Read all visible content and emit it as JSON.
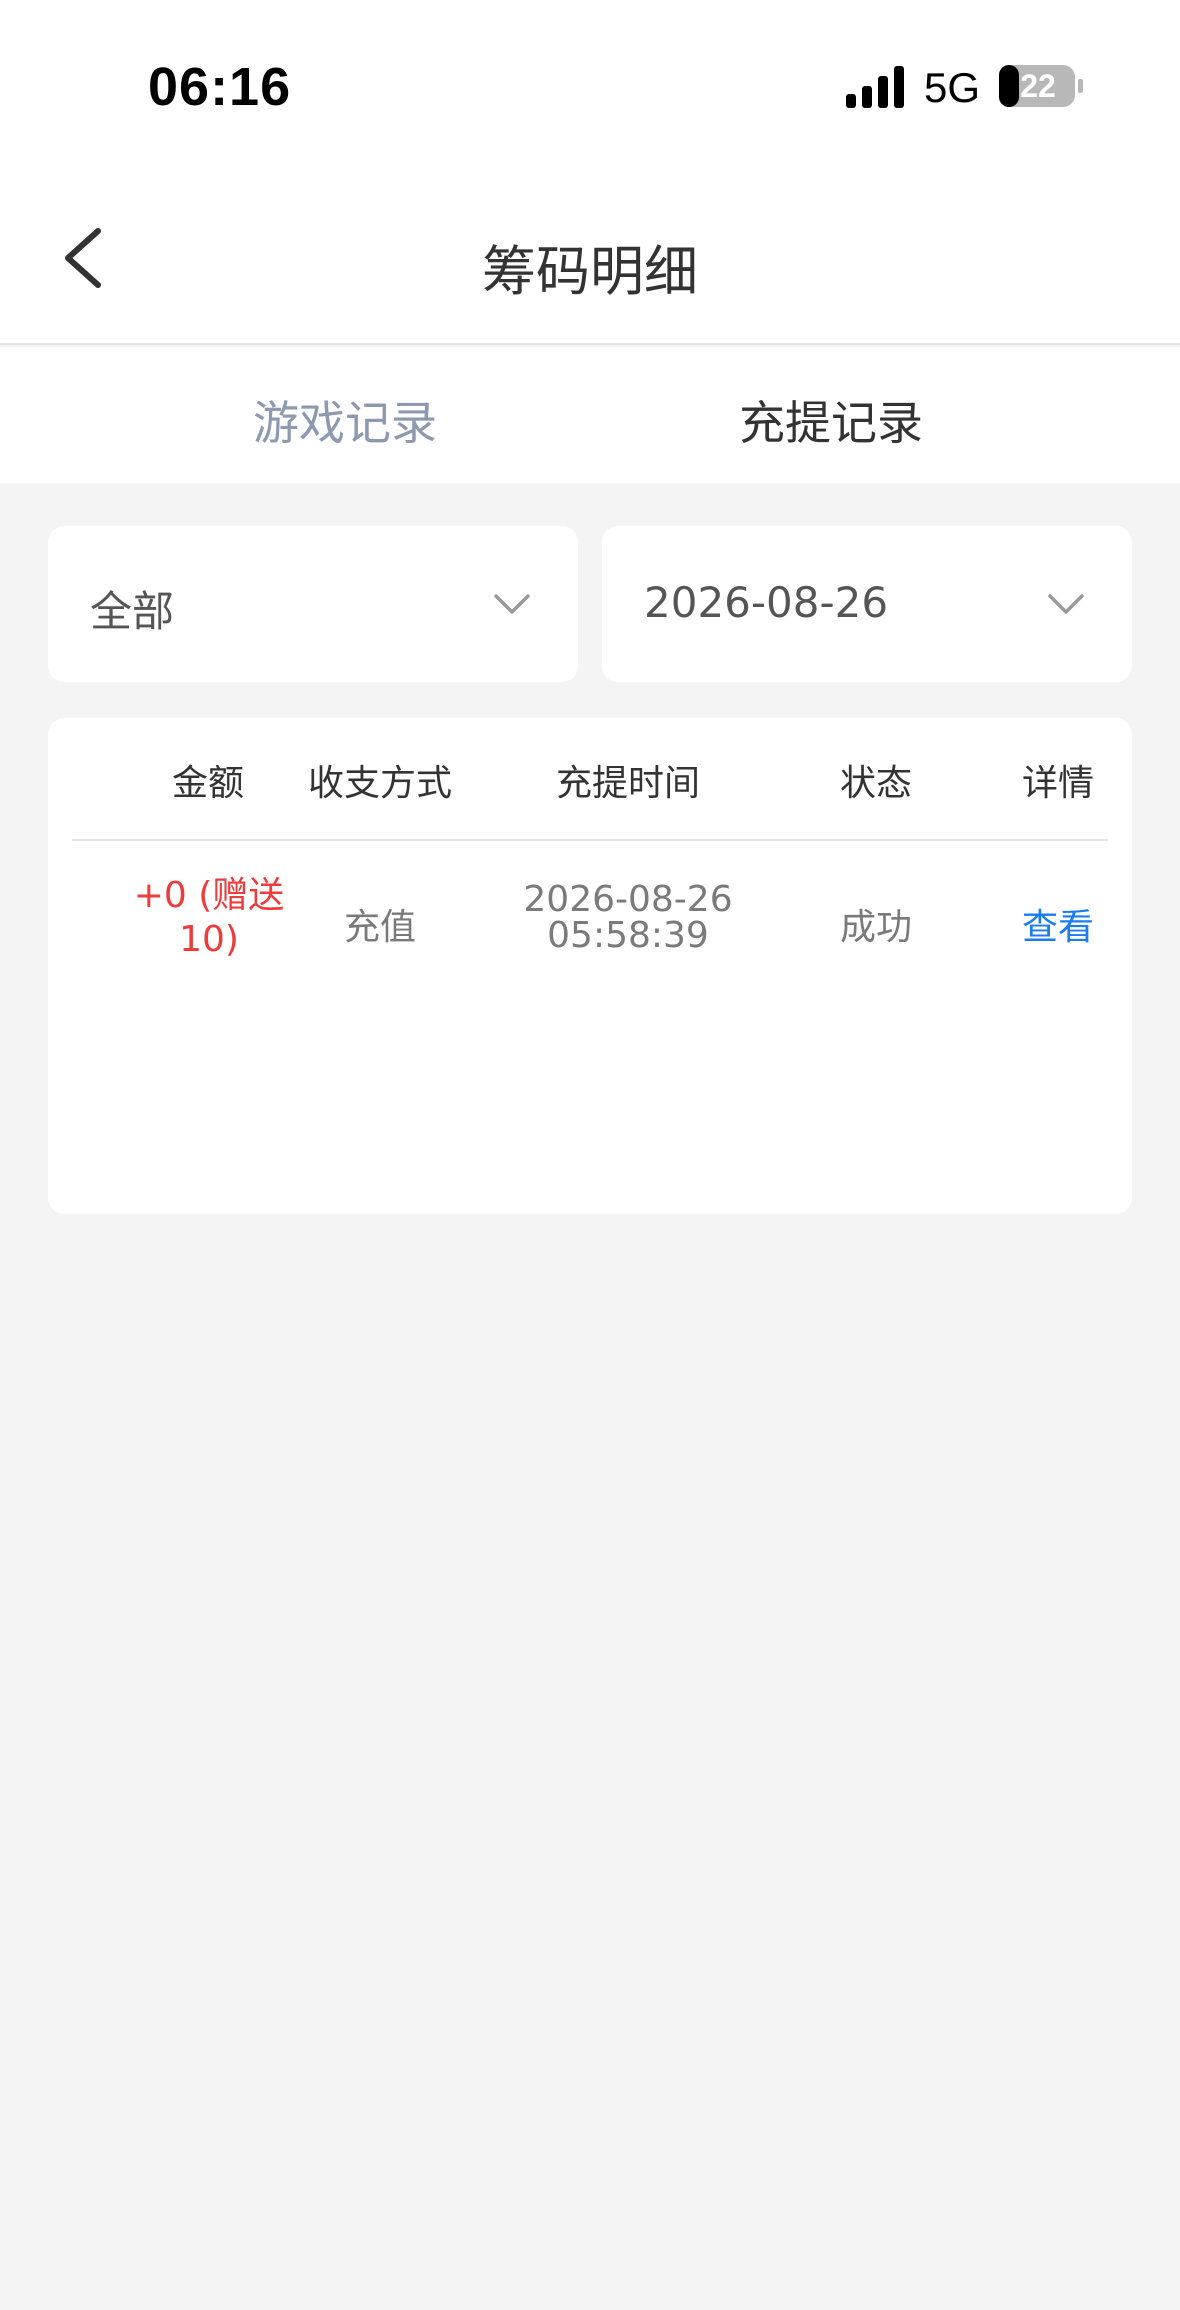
{
  "status_bar": {
    "time": "06:16",
    "network": "5G",
    "battery": "22"
  },
  "header": {
    "title": "筹码明细"
  },
  "tabs": [
    {
      "label": "游戏记录",
      "active": false
    },
    {
      "label": "充提记录",
      "active": true
    }
  ],
  "filters": {
    "type": "全部",
    "date": "2026-08-26"
  },
  "table": {
    "columns": [
      "金额",
      "收支方式",
      "充提时间",
      "状态",
      "详情"
    ],
    "rows": [
      {
        "amount_line1": "+0 (赠送",
        "amount_line2": "10)",
        "method": "充值",
        "date": "2026-08-26",
        "time": "05:58:39",
        "status": "成功",
        "detail": "查看"
      }
    ]
  },
  "colors": {
    "accent_link": "#1a7cf0",
    "amount_red": "#ee3b3b",
    "inactive_tab": "#8c99b0",
    "background": "#f4f4f4"
  },
  "icons": [
    "back-arrow-icon",
    "chevron-down-icon",
    "signal-icon",
    "battery-icon"
  ]
}
